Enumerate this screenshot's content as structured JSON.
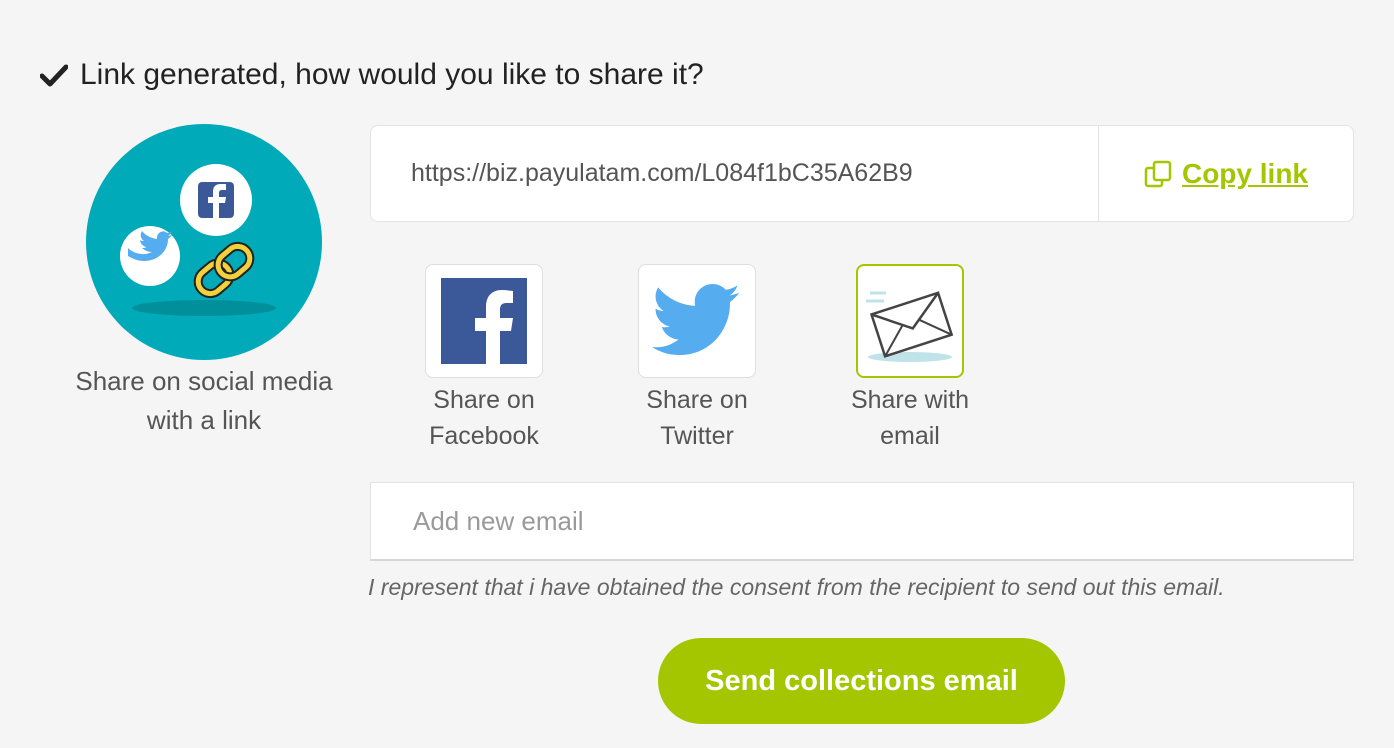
{
  "header": {
    "icon": "checkmark-icon",
    "title": "Link generated, how would you like to share it?"
  },
  "hero": {
    "icon": "social-share-illustration",
    "caption": "Share on social media with a link"
  },
  "link_box": {
    "url": "https://biz.payulatam.com/L084f1bC35A62B9",
    "copy_icon": "copy-icon",
    "copy_label": "Copy link"
  },
  "share_options": [
    {
      "icon": "facebook-icon",
      "label": "Share on Facebook",
      "selected": false
    },
    {
      "icon": "twitter-icon",
      "label": "Share on Twitter",
      "selected": false
    },
    {
      "icon": "email-envelope-icon",
      "label": "Share with email",
      "selected": true
    }
  ],
  "email": {
    "placeholder": "Add new email",
    "value": ""
  },
  "consent_text": "I represent that i have obtained the consent from the recipient to send out this email.",
  "send_button_label": "Send collections email",
  "colors": {
    "accent": "#a4c600",
    "teal": "#00aab9",
    "facebook": "#3b5998",
    "twitter": "#55acee",
    "background": "#f5f5f5"
  }
}
